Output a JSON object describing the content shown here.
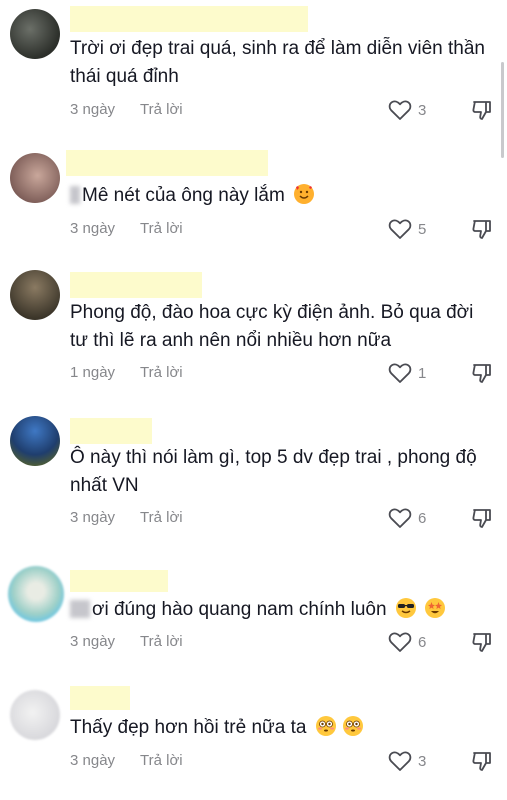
{
  "comments": [
    {
      "text": "Trời ơi đẹp trai quá, sinh ra để làm diễn viên thần thái quá đỉnh",
      "time": "3 ngày",
      "reply": "Trả lời",
      "likes": "3"
    },
    {
      "text": "Mê nét của ông này lắm",
      "time": "3 ngày",
      "reply": "Trả lời",
      "likes": "5",
      "emoji": [
        "smiling-face-with-hearts"
      ]
    },
    {
      "text": "Phong độ, đào hoa cực kỳ điện ảnh. Bỏ qua đời tư thì lẽ ra anh nên nổi nhiều hơn nữa",
      "time": "1 ngày",
      "reply": "Trả lời",
      "likes": "1"
    },
    {
      "text": "Ô này thì nói làm gì, top 5 dv đẹp trai , phong độ nhất VN",
      "time": "3 ngày",
      "reply": "Trả lời",
      "likes": "6"
    },
    {
      "text": "ơi đúng hào quang nam chính luôn",
      "time": "3 ngày",
      "reply": "Trả lời",
      "likes": "6",
      "emoji": [
        "smiling-face-with-sunglasses",
        "star-struck"
      ]
    },
    {
      "text": "Thấy đẹp hơn hồi trẻ nữa ta",
      "time": "3 ngày",
      "reply": "Trả lời",
      "likes": "3",
      "emoji": [
        "flushed-face",
        "flushed-face"
      ]
    }
  ],
  "colors": {
    "text": "#161823",
    "meta": "#86878b",
    "highlight": "#fdfbcc"
  },
  "icons": {
    "like": "heart-outline-icon",
    "dislike": "thumbs-down-icon"
  }
}
